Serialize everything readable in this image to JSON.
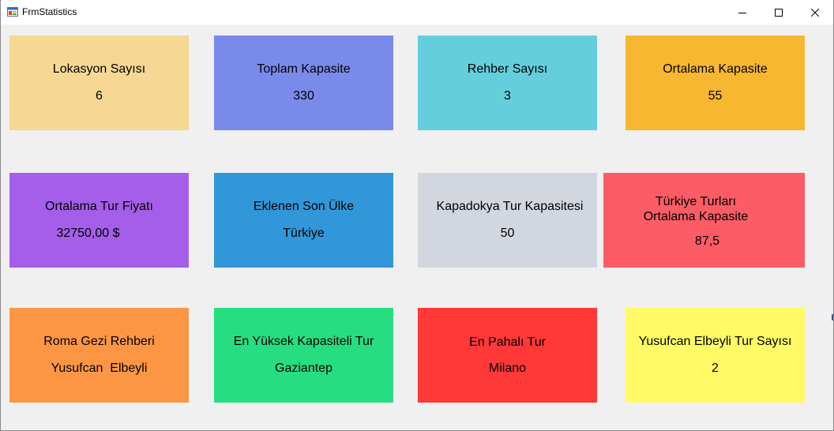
{
  "window": {
    "title": "FrmStatistics",
    "controls": [
      "minimize",
      "maximize",
      "close"
    ]
  },
  "colors": {
    "lokasyon": "#f6d894",
    "toplam_kapasite": "#7a8aea",
    "rehber": "#65cedc",
    "ortalama_kapasite": "#f7b731",
    "tur_fiyati": "#a55eea",
    "son_ulke": "#3197d9",
    "kapadokya": "#d2d7df",
    "turkiye_turlari": "#fc5c65",
    "roma_rehberi": "#fd9644",
    "yuksek_kapasite": "#26de81",
    "pahali_tur": "#ff3838",
    "yusufcan_tur": "#fffa65"
  },
  "cards": [
    {
      "label": "Lokasyon Sayısı",
      "value": "6"
    },
    {
      "label": "Toplam Kapasite",
      "value": "330"
    },
    {
      "label": "Rehber Sayısı",
      "value": "3"
    },
    {
      "label": "Ortalama Kapasite",
      "value": "55"
    },
    {
      "label": "Ortalama Tur Fiyatı",
      "value": "32750,00 $"
    },
    {
      "label": "Eklenen Son Ülke",
      "value": "Türkiye"
    },
    {
      "label": "Kapadokya Tur Kapasitesi",
      "value": "50"
    },
    {
      "label": "Türkiye Turları Ortalama Kapasite",
      "value": "87,5"
    },
    {
      "label": "Roma Gezi Rehberi",
      "value": "Yusufcan  Elbeyli"
    },
    {
      "label": "En Yüksek Kapasiteli Tur",
      "value": "Gaziantep"
    },
    {
      "label": "En Pahalı Tur",
      "value": "Milano"
    },
    {
      "label": "Yusufcan Elbeyli Tur Sayısı",
      "value": "2"
    }
  ]
}
